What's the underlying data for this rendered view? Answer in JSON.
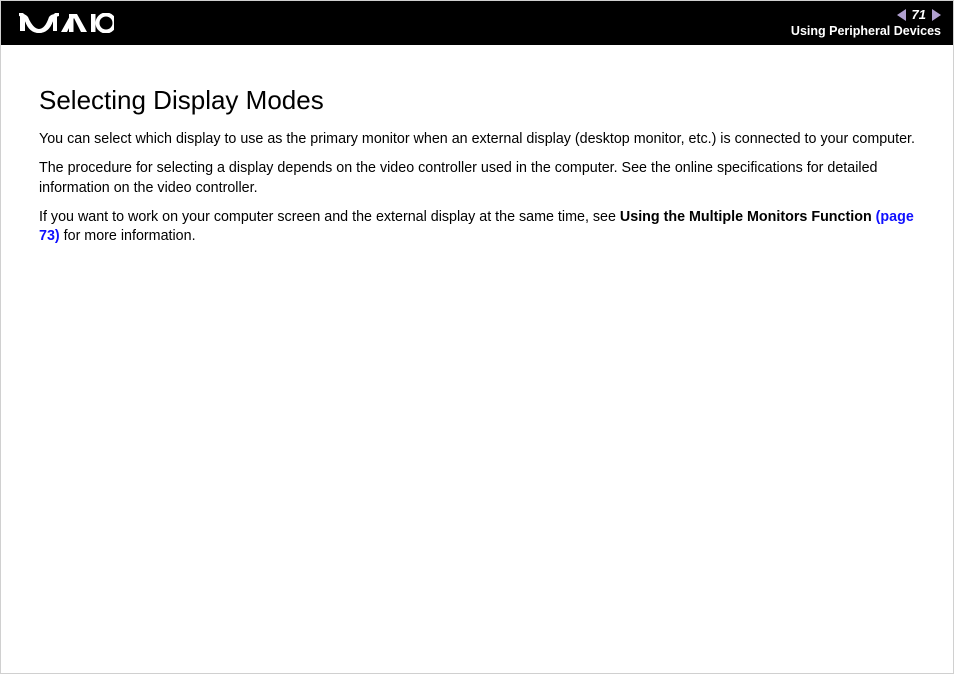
{
  "header": {
    "page_number": "71",
    "section": "Using Peripheral Devices"
  },
  "content": {
    "heading": "Selecting Display Modes",
    "p1": "You can select which display to use as the primary monitor when an external display (desktop monitor, etc.) is connected to your computer.",
    "p2": "The procedure for selecting a display depends on the video controller used in the computer. See the online specifications for detailed information on the video controller.",
    "p3_a": "If you want to work on your computer screen and the external display at the same time, see ",
    "p3_bold": "Using the Multiple Monitors Function ",
    "p3_link": "(page 73)",
    "p3_b": " for more information."
  }
}
